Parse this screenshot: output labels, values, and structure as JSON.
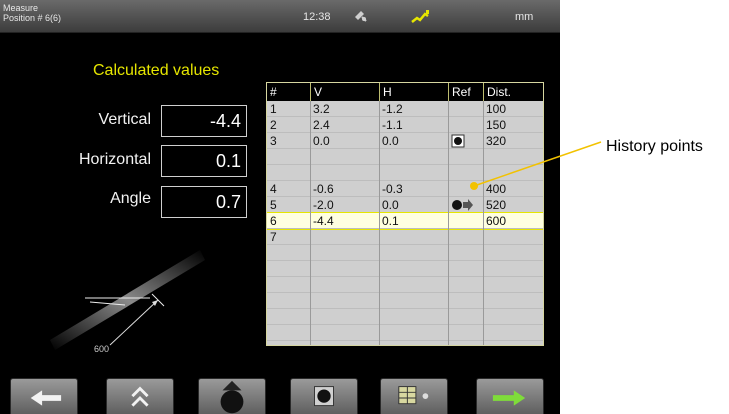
{
  "topbar": {
    "title_line1": "Measure",
    "title_line2": "Position # 6(6)",
    "time": "12:38",
    "unit": "mm",
    "connection_icon": "link-icon",
    "signal_icon": "signal-icon"
  },
  "calculated": {
    "title": "Calculated values",
    "vertical_label": "Vertical",
    "vertical_value": "-4.4",
    "horizontal_label": "Horizontal",
    "horizontal_value": "0.1",
    "angle_label": "Angle",
    "angle_value": "0.7"
  },
  "illustration": {
    "distance_label": "600"
  },
  "table": {
    "headers": [
      "#",
      "V",
      "H",
      "Ref",
      "Dist."
    ],
    "rows": [
      {
        "n": "1",
        "v": "3.2",
        "h": "-1.2",
        "ref": "",
        "dist": "100",
        "type": "normal"
      },
      {
        "n": "2",
        "v": "2.4",
        "h": "-1.1",
        "ref": "",
        "dist": "150",
        "type": "normal"
      },
      {
        "n": "3",
        "v": "0.0",
        "h": "0.0",
        "ref": "target-icon",
        "dist": "320",
        "type": "normal"
      },
      {
        "n": "",
        "v": "",
        "h": "",
        "ref": "",
        "dist": "",
        "type": "history"
      },
      {
        "n": "",
        "v": "",
        "h": "",
        "ref": "",
        "dist": "",
        "type": "history"
      },
      {
        "n": "4",
        "v": "-0.6",
        "h": "-0.3",
        "ref": "",
        "dist": "400",
        "type": "normal"
      },
      {
        "n": "5",
        "v": "-2.0",
        "h": "0.0",
        "ref": "arrow-target-icon",
        "dist": "520",
        "type": "normal"
      },
      {
        "n": "6",
        "v": "-4.4",
        "h": "0.1",
        "ref": "",
        "dist": "600",
        "type": "selected"
      },
      {
        "n": "7",
        "v": "",
        "h": "",
        "ref": "",
        "dist": "",
        "type": "normal"
      },
      {
        "n": "",
        "v": "",
        "h": "",
        "ref": "",
        "dist": "",
        "type": "normal"
      },
      {
        "n": "",
        "v": "",
        "h": "",
        "ref": "",
        "dist": "",
        "type": "normal"
      },
      {
        "n": "",
        "v": "",
        "h": "",
        "ref": "",
        "dist": "",
        "type": "normal"
      },
      {
        "n": "",
        "v": "",
        "h": "",
        "ref": "",
        "dist": "",
        "type": "normal"
      },
      {
        "n": "",
        "v": "",
        "h": "",
        "ref": "",
        "dist": "",
        "type": "normal"
      },
      {
        "n": "",
        "v": "",
        "h": "",
        "ref": "",
        "dist": "",
        "type": "normal"
      }
    ]
  },
  "annotation": {
    "history_points": "History points",
    "line_color": "#f2c200"
  },
  "bottombar": {
    "buttons": [
      {
        "name": "back-button",
        "icon": "arrow-left-icon"
      },
      {
        "name": "move-up-button",
        "icon": "double-chevron-up-icon"
      },
      {
        "name": "target-up-button",
        "icon": "target-icon"
      },
      {
        "name": "target-button",
        "icon": "target-icon"
      },
      {
        "name": "table-view-button",
        "icon": "table-icon"
      },
      {
        "name": "next-button",
        "icon": "arrow-right-icon"
      }
    ]
  },
  "colors": {
    "accent_yellow": "#e6e600",
    "screen_bg": "#000000",
    "table_bg": "#cfcfcf"
  }
}
